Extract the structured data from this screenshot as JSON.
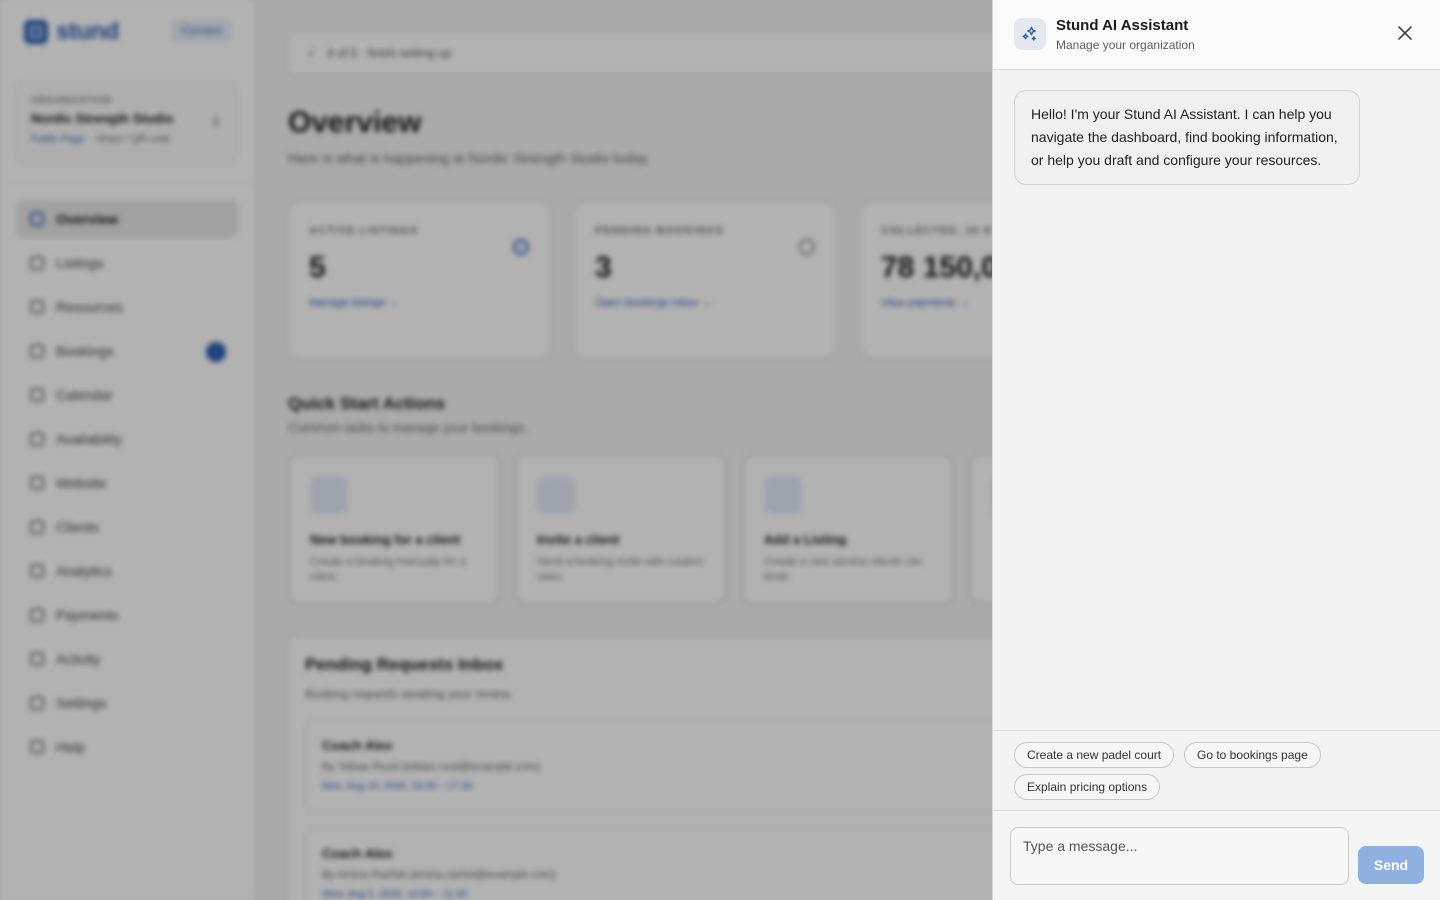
{
  "colors": {
    "brand": "#2f5fb3",
    "send_button": "#8fb1e2",
    "panel_bg": "#f3f3f3",
    "overlay": "rgba(0,0,0,0.30)"
  },
  "background": {
    "brand_name": "stund",
    "brand_badge": "Connect",
    "org": {
      "label": "ORGANIZATION",
      "name": "Nordic Strength Studio",
      "public_page": "Public Page",
      "share": "Share / QR code"
    },
    "nav": [
      {
        "label": "Overview",
        "icon": "home-icon",
        "active": true
      },
      {
        "label": "Listings",
        "icon": "grid-icon"
      },
      {
        "label": "Resources",
        "icon": "box-icon"
      },
      {
        "label": "Bookings",
        "icon": "clipboard-icon",
        "badge": true
      },
      {
        "label": "Calendar",
        "icon": "calendar-icon"
      },
      {
        "label": "Availability",
        "icon": "calendar-check-icon"
      },
      {
        "label": "Website",
        "icon": "brush-icon"
      },
      {
        "label": "Clients",
        "icon": "id-card-icon"
      },
      {
        "label": "Analytics",
        "icon": "bar-chart-icon"
      },
      {
        "label": "Payments",
        "icon": "wallet-icon"
      },
      {
        "label": "Activity",
        "icon": "pulse-icon"
      },
      {
        "label": "Settings",
        "icon": "gear-icon"
      },
      {
        "label": "Help",
        "icon": "help-icon"
      }
    ],
    "setup_status": "4 of 5 · finish setting up",
    "title": "Overview",
    "subtitle": "Here is what is happening at Nordic Strength Studio today.",
    "stats": [
      {
        "label": "ACTIVE LISTINGS",
        "value": "5",
        "link": "Manage listings →"
      },
      {
        "label": "PENDING BOOKINGS",
        "value": "3",
        "link": "Open bookings inbox →"
      },
      {
        "label": "COLLECTED, 30 D",
        "value": "78 150,0",
        "link": "View payments →"
      }
    ],
    "quick_title": "Quick Start Actions",
    "quick_subtitle": "Common tasks to manage your bookings.",
    "quick_actions": [
      {
        "title": "New booking for a client",
        "desc": "Create a booking manually for a client."
      },
      {
        "title": "Invite a client",
        "desc": "Send a booking invite with custom rates."
      },
      {
        "title": "Add a Listing",
        "desc": "Create a new service clients can book."
      }
    ],
    "inbox_title": "Pending Requests Inbox",
    "inbox_subtitle": "Booking requests awaiting your review.",
    "requests": [
      {
        "name": "Coach Alex",
        "by": "By Tobias Ruud (tobias.ruud@example.com)",
        "time": "Mon, Aug 10, 2026, 16:00 – 17:30"
      },
      {
        "name": "Coach Alex",
        "by": "By Amina Rashid (amina.rashid@example.com)",
        "time": "Wed, Aug 5, 2026, 10:00 – 11:30"
      }
    ]
  },
  "assistant": {
    "title": "Stund AI Assistant",
    "subtitle": "Manage your organization",
    "logo_icon": "sparkles-icon",
    "close_icon": "close-icon",
    "messages": [
      {
        "role": "assistant",
        "text": "Hello! I'm your Stund AI Assistant. I can help you navigate the dashboard, find booking information, or help you draft and configure your resources."
      }
    ],
    "suggestions": [
      "Create a new padel court",
      "Go to bookings page",
      "Explain pricing options"
    ],
    "input_placeholder": "Type a message...",
    "send_label": "Send"
  }
}
